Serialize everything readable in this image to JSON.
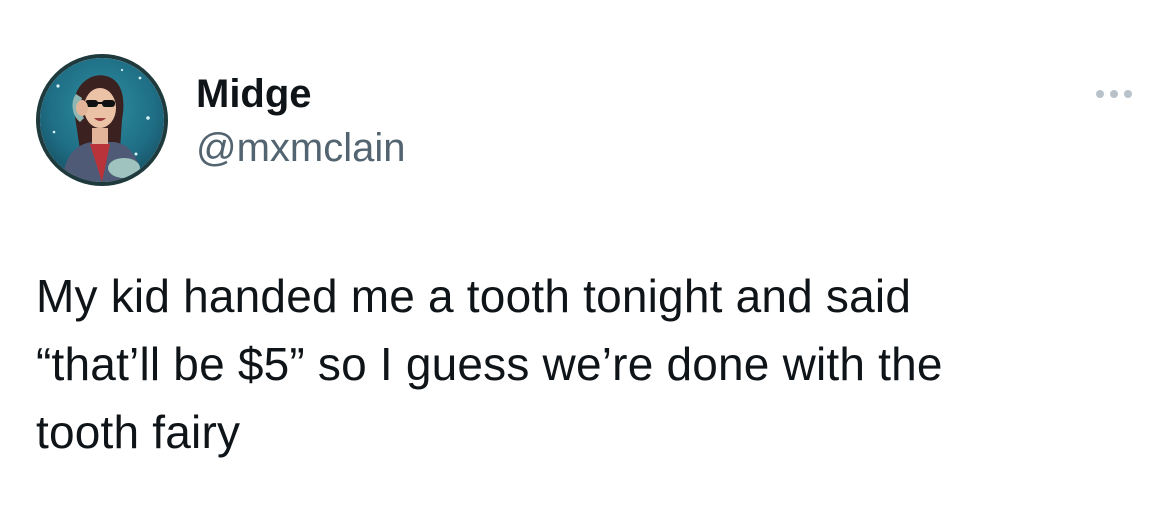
{
  "tweet": {
    "author": {
      "display_name": "Midge",
      "handle": "@mxmclain",
      "avatar_icon": "user-avatar-photo"
    },
    "more_icon": "more-horizontal-icon",
    "text": "My kid handed me a tooth tonight and said\n“that’ll be $5” so I guess we’re done with the\ntooth fairy"
  },
  "colors": {
    "text_primary": "#0f1419",
    "text_secondary": "#536471",
    "icon_muted": "#b9c2c9",
    "background": "#ffffff"
  }
}
